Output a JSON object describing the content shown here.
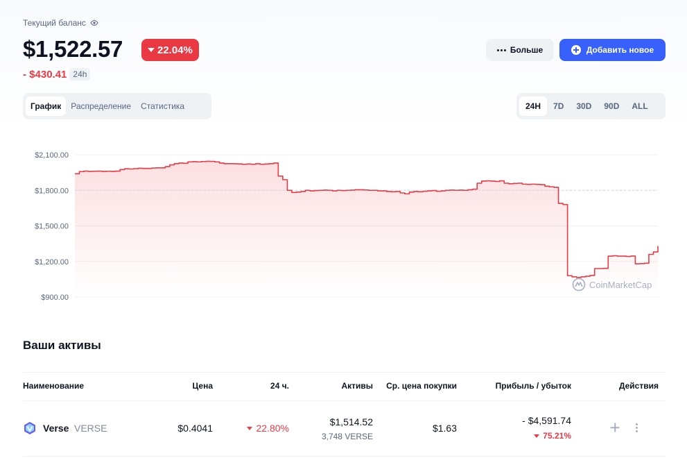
{
  "balance": {
    "label": "Текущий баланс",
    "value": "$1,522.57",
    "change_pct": "22.04%",
    "change_abs": "- $430.41",
    "period": "24h"
  },
  "actions": {
    "more_label": "Больше",
    "add_label": "Добавить новое"
  },
  "tabs": [
    {
      "label": "График",
      "active": true
    },
    {
      "label": "Распределение",
      "active": false
    },
    {
      "label": "Статистика",
      "active": false
    }
  ],
  "ranges": [
    {
      "label": "24H",
      "active": true
    },
    {
      "label": "7D",
      "active": false
    },
    {
      "label": "30D",
      "active": false
    },
    {
      "label": "90D",
      "active": false
    },
    {
      "label": "ALL",
      "active": false
    }
  ],
  "chart_data": {
    "type": "area",
    "title": "",
    "xlabel": "",
    "ylabel": "",
    "ylim": [
      900,
      2100
    ],
    "yticks": [
      {
        "value": 2100,
        "label": "$2,100.00"
      },
      {
        "value": 1800,
        "label": "$1,800.00"
      },
      {
        "value": 1500,
        "label": "$1,500.00"
      },
      {
        "value": 1200,
        "label": "$1,200.00"
      },
      {
        "value": 900,
        "label": "$900.00"
      }
    ],
    "reference_value": 1800,
    "watermark": "CoinMarketCap",
    "colors": {
      "line": "#ea3943",
      "fill": "#ea3943",
      "grid": "#eff2f5",
      "reference": "#cfd6e4"
    },
    "series": [
      {
        "values": [
          1940,
          1958,
          1962,
          1960,
          1961,
          1962,
          1960,
          1961,
          1960,
          1962,
          1975,
          1982,
          1980,
          1983,
          1986,
          1985,
          1985,
          1988,
          1990,
          1990,
          2000,
          2015,
          2025,
          2030,
          2028,
          2040,
          2042,
          2040,
          2043,
          2045,
          2044,
          2040,
          2030,
          2025,
          2025,
          2024,
          2023,
          2020,
          2022,
          2020,
          2024,
          2020,
          2022,
          2025,
          2030,
          1920,
          1890,
          1800,
          1782,
          1785,
          1790,
          1800,
          1795,
          1798,
          1800,
          1802,
          1800,
          1795,
          1800,
          1798,
          1800,
          1802,
          1805,
          1805,
          1803,
          1800,
          1800,
          1795,
          1795,
          1790,
          1788,
          1790,
          1778,
          1770,
          1785,
          1790,
          1788,
          1792,
          1795,
          1798,
          1792,
          1795,
          1800,
          1802,
          1800,
          1802,
          1800,
          1805,
          1810,
          1860,
          1878,
          1880,
          1878,
          1875,
          1880,
          1860,
          1855,
          1858,
          1860,
          1852,
          1850,
          1852,
          1850,
          1848,
          1835,
          1830,
          1825,
          1690,
          1680,
          1080,
          1070,
          1065,
          1070,
          1075,
          1082,
          1140,
          1140,
          1142,
          1245,
          1248,
          1245,
          1245,
          1242,
          1246,
          1180,
          1182,
          1185,
          1260,
          1280,
          1330
        ]
      }
    ]
  },
  "assets": {
    "title": "Ваши активы",
    "columns": [
      "Наименование",
      "Цена",
      "24 ч.",
      "Активы",
      "Ср. цена покупки",
      "Прибыль / убыток",
      "Действия"
    ],
    "rows": [
      {
        "name": "Verse",
        "symbol": "VERSE",
        "price": "$0.4041",
        "change_24h": "22.80%",
        "holdings_value": "$1,514.52",
        "holdings_amount": "3,748 VERSE",
        "avg_buy_price": "$1.63",
        "pnl_value": "- $4,591.74",
        "pnl_pct": "75.21%"
      }
    ]
  }
}
